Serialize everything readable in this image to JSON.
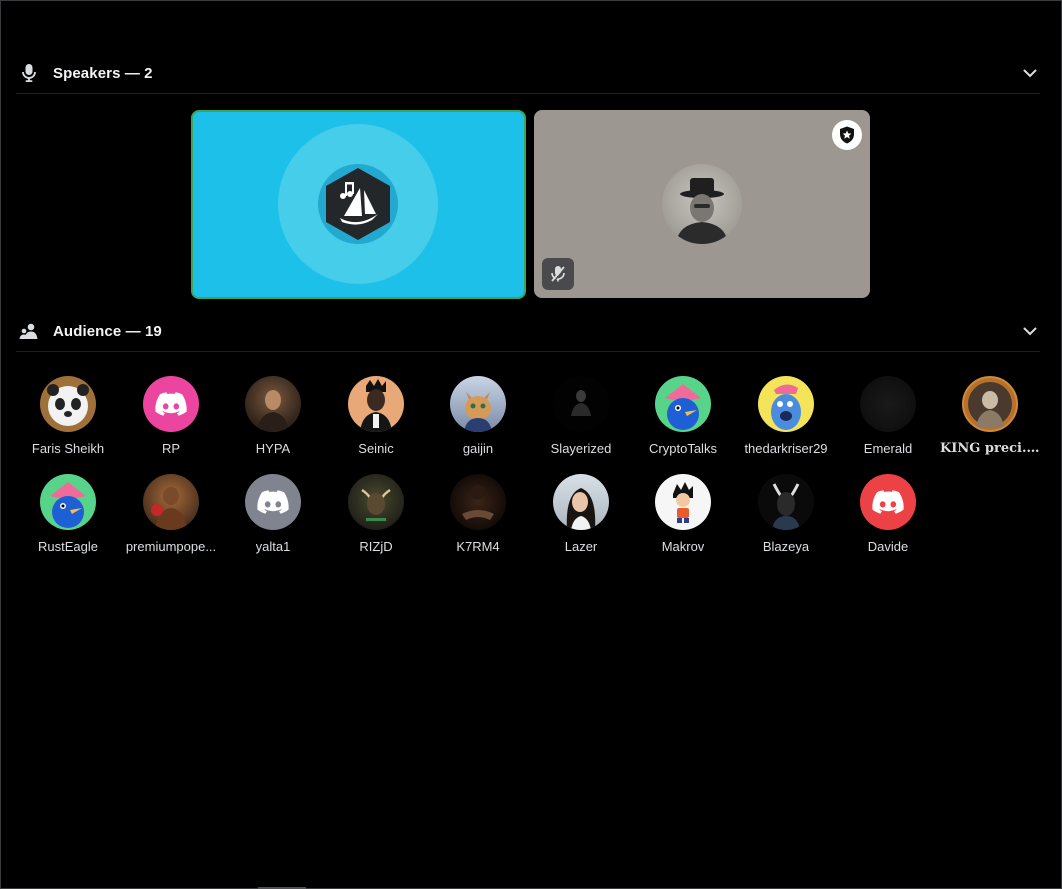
{
  "speakers_section": {
    "title": "Speakers — 2",
    "icon": "microphone-icon",
    "chevron": "chevron-down-icon"
  },
  "speakers": [
    {
      "id": "music-bot",
      "bg_color": "#1cc0e8",
      "speaking": true,
      "border_color": "#3ba55c"
    },
    {
      "id": "speaker-2",
      "bg_color": "#9c9891",
      "moderator": true,
      "muted": true
    }
  ],
  "audience_section": {
    "title": "Audience — 19",
    "icon": "audience-icon",
    "chevron": "chevron-down-icon"
  },
  "audience": [
    {
      "name": "Faris Sheikh",
      "avatar": "panda-avatar"
    },
    {
      "name": "RP",
      "avatar": "discord-logo",
      "color": "#eb459f"
    },
    {
      "name": "HYPA",
      "avatar": "photo-avatar"
    },
    {
      "name": "Seinic",
      "avatar": "illustrated-avatar"
    },
    {
      "name": "gaijin",
      "avatar": "cat-avatar"
    },
    {
      "name": "Slayerized",
      "avatar": "dark-figure-avatar"
    },
    {
      "name": "CryptoTalks",
      "avatar": "bird-avatar"
    },
    {
      "name": "thedarkriser29",
      "avatar": "blue-creature-avatar"
    },
    {
      "name": "Emerald",
      "avatar": "dark-avatar"
    },
    {
      "name": "KING preci...",
      "avatar": "framed-avatar",
      "boost": "◍"
    },
    {
      "name": "RustEagle",
      "avatar": "bird-avatar"
    },
    {
      "name": "premiumpope...",
      "avatar": "boxer-avatar"
    },
    {
      "name": "yalta1",
      "avatar": "discord-logo",
      "color": "#80848e"
    },
    {
      "name": "RIZjD",
      "avatar": "bull-avatar"
    },
    {
      "name": "K7RM4",
      "avatar": "dark-hands-avatar"
    },
    {
      "name": "Lazer",
      "avatar": "woman-avatar"
    },
    {
      "name": "Makrov",
      "avatar": "anime-avatar"
    },
    {
      "name": "Blazeya",
      "avatar": "goat-avatar"
    },
    {
      "name": "Davide",
      "avatar": "discord-logo",
      "color": "#ed4245"
    }
  ]
}
